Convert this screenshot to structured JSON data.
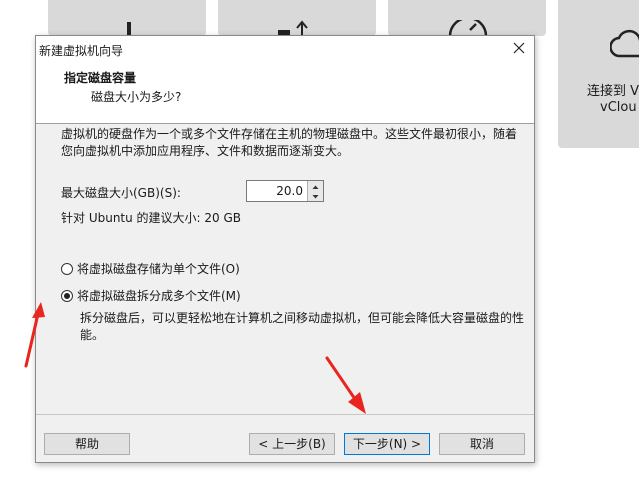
{
  "background_tiles": {
    "tile4_line1": "连接到 V",
    "tile4_line2": "vClou"
  },
  "dialog": {
    "title": "新建虚拟机向导",
    "header_title": "指定磁盘容量",
    "header_subtitle": "磁盘大小为多少?",
    "description": "虚拟机的硬盘作为一个或多个文件存储在主机的物理磁盘中。这些文件最初很小，随着您向虚拟机中添加应用程序、文件和数据而逐渐变大。",
    "max_size_label": "最大磁盘大小(GB)(S):",
    "max_size_value": "20.0",
    "recommended": "针对 Ubuntu 的建议大小: 20 GB",
    "options": [
      {
        "label": "将虚拟磁盘存储为单个文件(O)",
        "selected": false
      },
      {
        "label": "将虚拟磁盘拆分成多个文件(M)",
        "selected": true
      }
    ],
    "option_description": "拆分磁盘后，可以更轻松地在计算机之间移动虚拟机，但可能会降低大容量磁盘的性能。",
    "buttons": {
      "help": "帮助",
      "back": "< 上一步(B)",
      "next": "下一步(N) >",
      "cancel": "取消"
    }
  },
  "colors": {
    "annotation_arrow": "#e8251f",
    "focus_border": "#0078d7"
  }
}
